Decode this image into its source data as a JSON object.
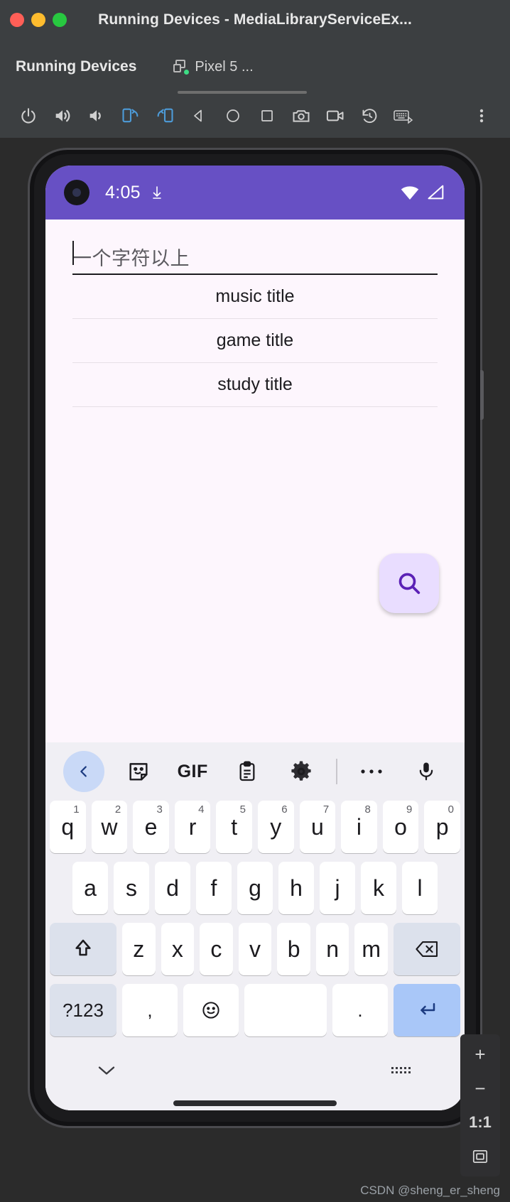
{
  "window": {
    "title": "Running Devices - MediaLibraryServiceEx...",
    "traffic_lights": [
      "close",
      "minimize",
      "maximize"
    ]
  },
  "tool_window": {
    "title": "Running Devices",
    "device_tab": "Pixel 5 ..."
  },
  "emulator_toolbar": {
    "buttons": [
      {
        "name": "power-button",
        "icon": "power"
      },
      {
        "name": "volume-up-button",
        "icon": "volume-up"
      },
      {
        "name": "volume-down-button",
        "icon": "volume-down"
      },
      {
        "name": "rotate-left-button",
        "icon": "rotate-left"
      },
      {
        "name": "rotate-right-button",
        "icon": "rotate-right"
      },
      {
        "name": "back-button",
        "icon": "triangle-back"
      },
      {
        "name": "home-button",
        "icon": "circle-home"
      },
      {
        "name": "overview-button",
        "icon": "square-overview"
      },
      {
        "name": "screenshot-button",
        "icon": "camera"
      },
      {
        "name": "record-screen-button",
        "icon": "video-camera"
      },
      {
        "name": "history-button",
        "icon": "history"
      },
      {
        "name": "hardware-input-button",
        "icon": "keyboard"
      },
      {
        "name": "more-button",
        "icon": "kebab-menu"
      }
    ]
  },
  "device": {
    "status_bar": {
      "time": "4:05",
      "icons": [
        "download-indicator",
        "wifi",
        "cellular-signal"
      ]
    },
    "app": {
      "search_hint": "一个字符以上",
      "search_value": "",
      "list_items": [
        "music title",
        "game title",
        "study title"
      ],
      "fab": "search-icon"
    },
    "keyboard": {
      "toolbar": [
        {
          "name": "kb-back",
          "glyph": "‹"
        },
        {
          "name": "sticker-icon",
          "glyph": "sticker"
        },
        {
          "name": "gif-icon",
          "glyph": "GIF"
        },
        {
          "name": "clipboard-icon",
          "glyph": "clipboard"
        },
        {
          "name": "settings-gear-icon",
          "glyph": "gear"
        },
        {
          "name": "more-options-icon",
          "glyph": "•••"
        },
        {
          "name": "microphone-icon",
          "glyph": "mic"
        }
      ],
      "row1": [
        {
          "key": "q",
          "num": "1"
        },
        {
          "key": "w",
          "num": "2"
        },
        {
          "key": "e",
          "num": "3"
        },
        {
          "key": "r",
          "num": "4"
        },
        {
          "key": "t",
          "num": "5"
        },
        {
          "key": "y",
          "num": "6"
        },
        {
          "key": "u",
          "num": "7"
        },
        {
          "key": "i",
          "num": "8"
        },
        {
          "key": "o",
          "num": "9"
        },
        {
          "key": "p",
          "num": "0"
        }
      ],
      "row2": [
        "a",
        "s",
        "d",
        "f",
        "g",
        "h",
        "j",
        "k",
        "l"
      ],
      "row3": {
        "shift": "shift-key",
        "letters": [
          "z",
          "x",
          "c",
          "v",
          "b",
          "n",
          "m"
        ],
        "backspace": "backspace-key"
      },
      "row4": {
        "symbols": "?123",
        "comma": ",",
        "emoji": "emoji-key",
        "space": "",
        "period": ".",
        "enter": "enter-key"
      },
      "bottom": {
        "hide": "chevron-down-icon",
        "layout": "keyboard-switch-icon"
      }
    }
  },
  "zoom_controls": {
    "zoom_in": "+",
    "zoom_out": "−",
    "actual_size": "1:1",
    "fit_to_window": "fit-icon"
  },
  "watermark": "CSDN @sheng_er_sheng",
  "colors": {
    "chrome": "#3c3f41",
    "accent_purple": "#6750c4",
    "app_bg": "#fdf6fd",
    "fab_bg": "#e9ddff",
    "keyboard_bg": "#f0eff4"
  }
}
